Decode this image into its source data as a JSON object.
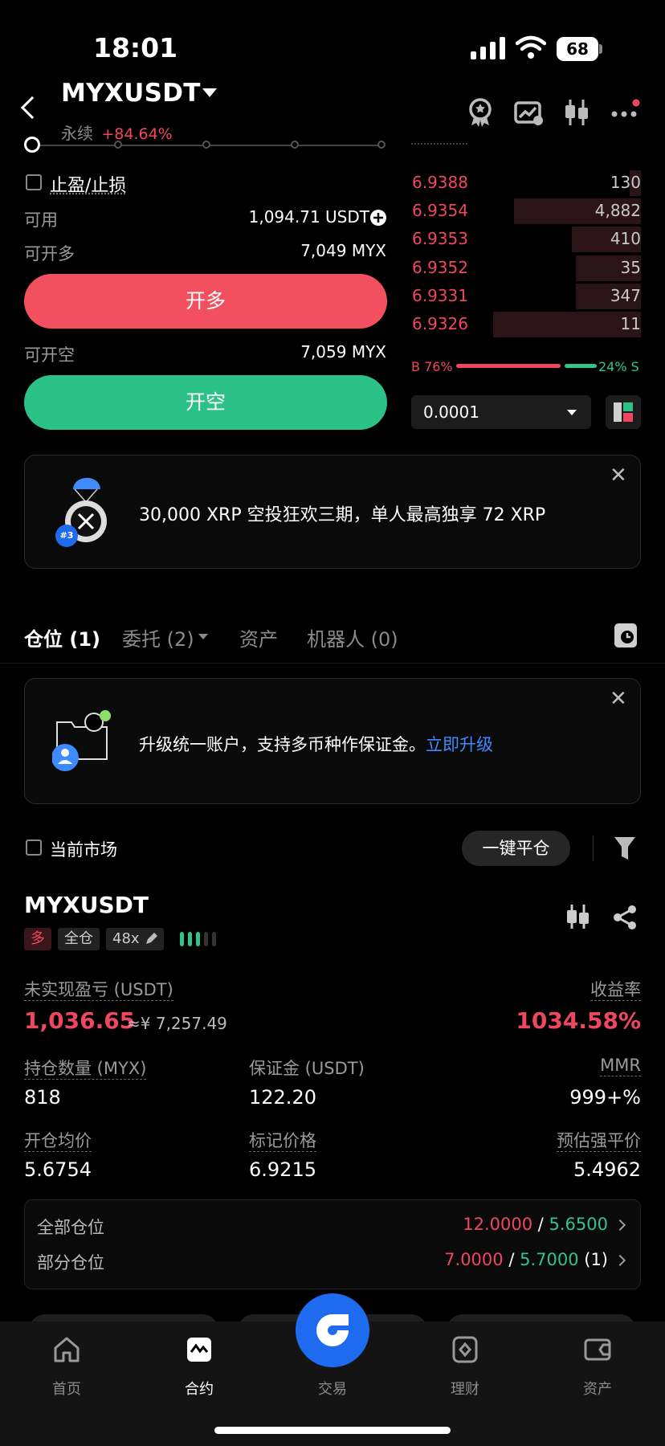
{
  "status_bar": {
    "time": "18:01",
    "battery": "68"
  },
  "header": {
    "symbol": "MYXUSDT",
    "type": "永续",
    "change": "+84.64%"
  },
  "form": {
    "tp_sl_label": "止盈/止损",
    "available_label": "可用",
    "available_value": "1,094.71 USDT",
    "can_long_label": "可开多",
    "can_long_value": "7,049 MYX",
    "long_button": "开多",
    "can_short_label": "可开空",
    "can_short_value": "7,059 MYX",
    "short_button": "开空"
  },
  "orderbook": {
    "rows": [
      {
        "price": "6.9388",
        "qty": "130",
        "depth": 0.05
      },
      {
        "price": "6.9354",
        "qty": "4,882",
        "depth": 0.55
      },
      {
        "price": "6.9353",
        "qty": "410",
        "depth": 0.3
      },
      {
        "price": "6.9352",
        "qty": "35",
        "depth": 0.28
      },
      {
        "price": "6.9331",
        "qty": "347",
        "depth": 0.28
      },
      {
        "price": "6.9326",
        "qty": "11",
        "depth": 0.64
      }
    ],
    "buy_ratio": "B 76%",
    "sell_ratio": "24% S",
    "precision": "0.0001"
  },
  "promo": {
    "text": "30,000 XRP 空投狂欢三期，单人最高独享 72 XRP",
    "badge": "#3"
  },
  "tabs": [
    {
      "label": "仓位 (1)"
    },
    {
      "label": "委托 (2)"
    },
    {
      "label": "资产"
    },
    {
      "label": "机器人 (0)"
    }
  ],
  "upgrade": {
    "text": "升级统一账户，支持多币种作保证金。",
    "link": "立即升级"
  },
  "filter": {
    "current_market": "当前市场",
    "close_all": "一键平仓"
  },
  "position": {
    "symbol": "MYXUSDT",
    "side_tag": "多",
    "margin_tag": "全仓",
    "leverage_tag": "48x",
    "upnl_label": "未实现盈亏 (USDT)",
    "upnl_value": "1,036.65",
    "upnl_cny": "≈¥ 7,257.49",
    "roe_label": "收益率",
    "roe_value": "1034.58%",
    "qty_label": "持仓数量 (MYX)",
    "qty_value": "818",
    "margin_label": "保证金 (USDT)",
    "margin_value": "122.20",
    "mmr_label": "MMR",
    "mmr_value": "999+%",
    "entry_label": "开仓均价",
    "entry_value": "5.6754",
    "mark_label": "标记价格",
    "mark_value": "6.9215",
    "liq_label": "预估强平价",
    "liq_value": "5.4962",
    "all_label": "全部仓位",
    "all_tp": "12.0000",
    "all_sl": "5.6500",
    "partial_label": "部分仓位",
    "partial_tp": "7.0000",
    "partial_sl": "5.7000",
    "partial_count": "(1)"
  },
  "nav": [
    {
      "label": "首页"
    },
    {
      "label": "合约"
    },
    {
      "label": "交易"
    },
    {
      "label": "理财"
    },
    {
      "label": "资产"
    }
  ]
}
